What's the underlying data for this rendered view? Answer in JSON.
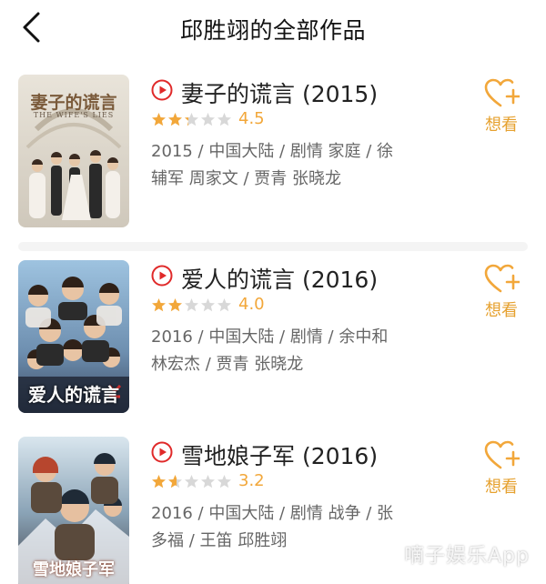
{
  "header": {
    "title": "邱胜翊的全部作品"
  },
  "movies": [
    {
      "title": "妻子的谎言 (2015)",
      "rating": 4.5,
      "rating_text": "4.5",
      "meta_line1": "2015 / 中国大陆 / 剧情 家庭 / 徐",
      "meta_line2": "辅军 周家文 / 贾青 张晓龙",
      "want_label": "想看",
      "poster_title": "妻子的谎言",
      "poster_subtitle": "THE WIFE'S LIES"
    },
    {
      "title": "爱人的谎言 (2016)",
      "rating": 4.0,
      "rating_text": "4.0",
      "meta_line1": "2016 / 中国大陆 / 剧情 / 余中和",
      "meta_line2": "林宏杰 / 贾青 张晓龙",
      "want_label": "想看",
      "poster_title": "爱人的谎言"
    },
    {
      "title": "雪地娘子军 (2016)",
      "rating": 3.2,
      "rating_text": "3.2",
      "meta_line1": "2016 / 中国大陆 / 剧情 战争 / 张",
      "meta_line2": "多福 / 王笛 邱胜翊",
      "want_label": "想看",
      "poster_title": "雪地娘子军"
    }
  ],
  "watermark": "嘀子娱乐App",
  "colors": {
    "accent": "#f2a73a",
    "play": "#e02a2a",
    "star_empty": "#d8d8d8",
    "meta": "#666666"
  }
}
